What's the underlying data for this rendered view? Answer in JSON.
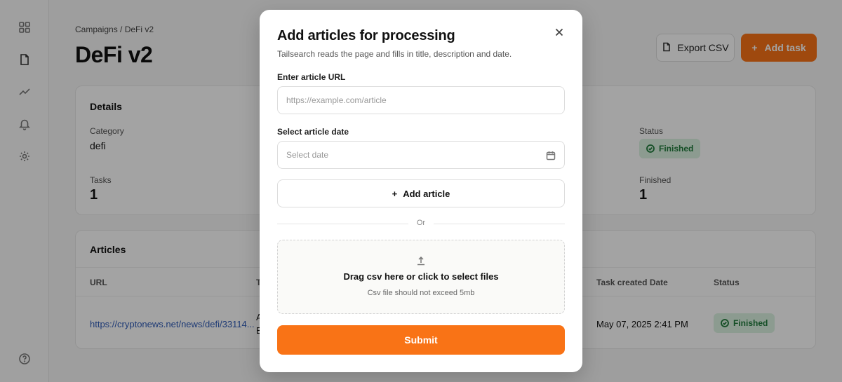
{
  "sidebar": {
    "icons": [
      "grid-icon",
      "document-icon",
      "trend-icon",
      "bell-icon",
      "settings-icon",
      "help-icon"
    ]
  },
  "header": {
    "breadcrumb": "Campaigns / DeFi v2",
    "title": "DeFi v2",
    "export_label": "Export CSV",
    "add_task_label": "Add task",
    "add_task_plus": "+"
  },
  "details": {
    "title": "Details",
    "category_label": "Category",
    "category_value": "defi",
    "status_label": "Status",
    "status_value": "Finished",
    "tasks_label": "Tasks",
    "tasks_value": "1",
    "finished_label": "Finished",
    "finished_value": "1"
  },
  "articles": {
    "title": "Articles",
    "columns": {
      "url": "URL",
      "title_partial": "T",
      "task_created": "Task created Date",
      "status": "Status"
    },
    "rows": [
      {
        "url": "https://cryptonews.net/news/defi/33114...",
        "title_fragment_1": "A",
        "title_fragment_2": "E",
        "created": "May 07, 2025 2:41 PM",
        "status": "Finished"
      }
    ]
  },
  "modal": {
    "title": "Add articles for processing",
    "subtitle": "Tailsearch reads the page and fills in title, description and date.",
    "url_label": "Enter article URL",
    "url_placeholder": "https://example.com/article",
    "date_label": "Select article date",
    "date_placeholder": "Select date",
    "add_article_label": "Add article",
    "add_article_plus": "+",
    "or_text": "Or",
    "drop_title": "Drag csv here or click to select files",
    "drop_sub": "Csv file should not exceed 5mb",
    "submit_label": "Submit"
  },
  "colors": {
    "accent": "#f97316",
    "success_bg": "#dcf3e2",
    "success_text": "#1f7a3a",
    "link": "#2f5bb7"
  }
}
